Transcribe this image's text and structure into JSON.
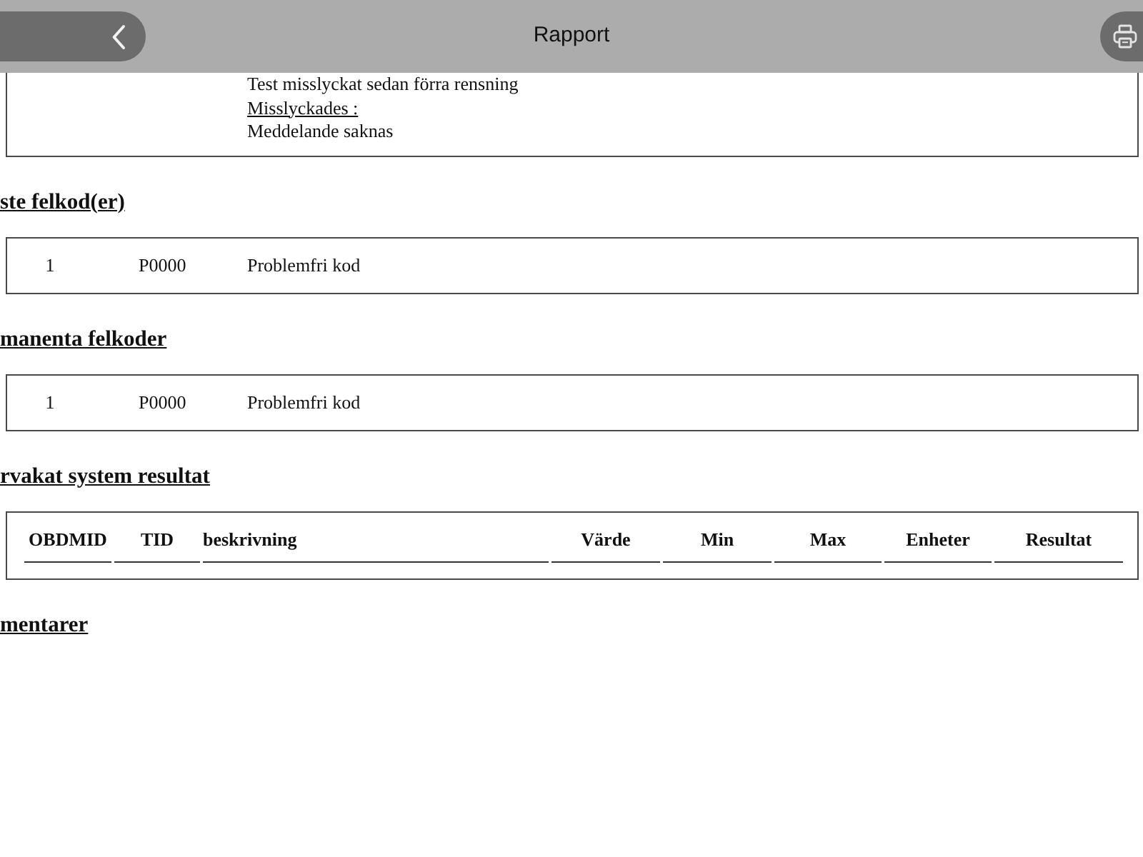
{
  "header": {
    "title": "Rapport"
  },
  "sections": [
    {
      "kind": "lines",
      "lines": [
        {
          "text": "Test misslyckat sedan förra rensning",
          "underlined": false
        },
        {
          "text": "Misslyckades :",
          "underlined": true
        },
        {
          "text": "Meddelande saknas",
          "underlined": false
        }
      ]
    },
    {
      "kind": "codes",
      "heading": "ste felkod(er)",
      "rows": [
        {
          "number": "1",
          "code": "P0000",
          "description": "Problemfri kod"
        }
      ]
    },
    {
      "kind": "codes",
      "heading": "manenta felkoder",
      "rows": [
        {
          "number": "1",
          "code": "P0000",
          "description": "Problemfri kod"
        }
      ]
    },
    {
      "kind": "table",
      "heading": "rvakat system resultat",
      "columns": [
        "OBDMID",
        "TID",
        "beskrivning",
        "Värde",
        "Min",
        "Max",
        "Enheter",
        "Resultat"
      ]
    },
    {
      "kind": "empty",
      "heading": "mentarer"
    }
  ]
}
